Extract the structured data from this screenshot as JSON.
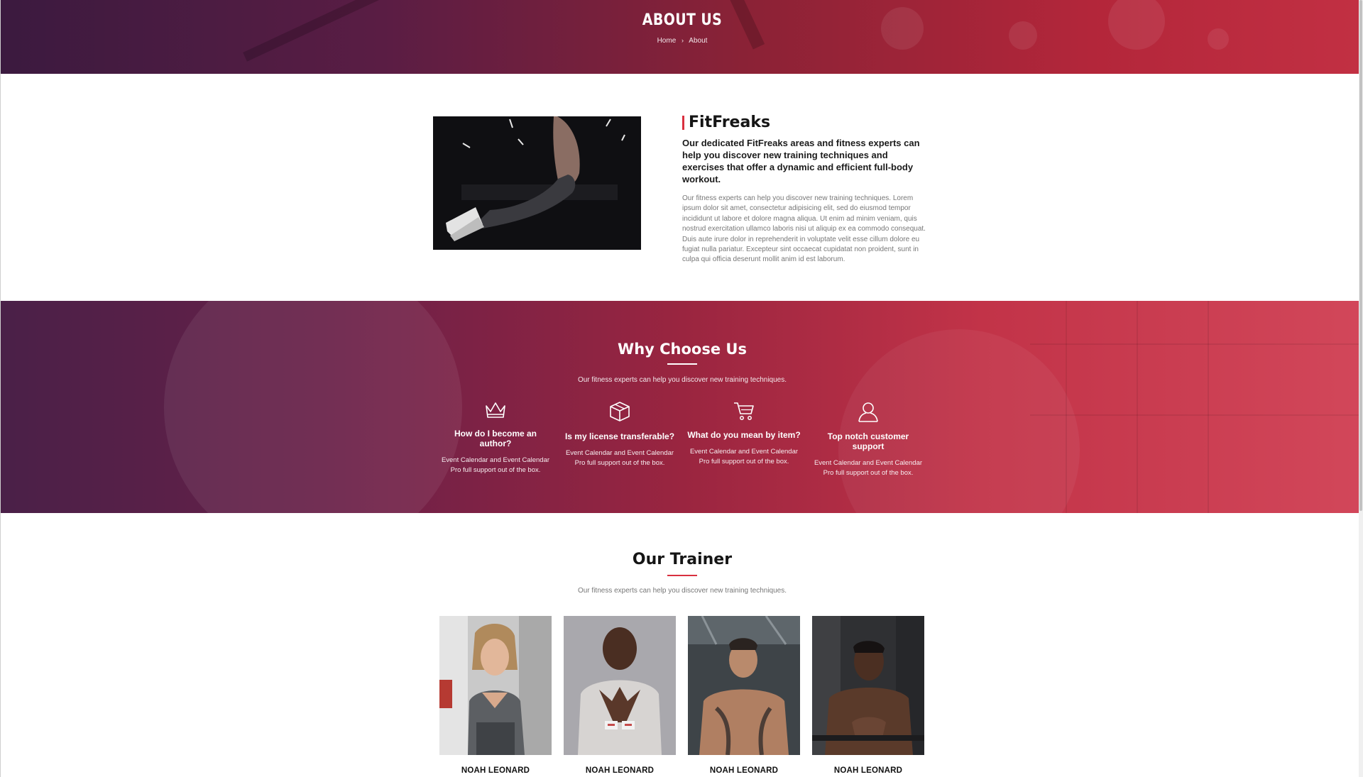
{
  "hero": {
    "title": "ABOUT US",
    "breadcrumb": {
      "home": "Home",
      "separator": "›",
      "current": "About"
    }
  },
  "about": {
    "brand": "FitFreaks",
    "lead": "Our dedicated FitFreaks areas and fitness experts can help you discover new training techniques and exercises that offer a dynamic and efficient full-body workout.",
    "body": "Our fitness experts can help you discover new training techniques. Lorem ipsum dolor sit amet, consectetur adipisicing elit, sed do eiusmod tempor incididunt ut labore et dolore magna aliqua. Ut enim ad minim veniam, quis nostrud exercitation ullamco laboris nisi ut aliquip ex ea commodo consequat. Duis aute irure dolor in reprehenderit in voluptate velit esse cillum dolore eu fugiat nulla pariatur. Excepteur sint occaecat cupidatat non proident, sunt in culpa qui officia deserunt mollit anim id est laborum."
  },
  "why": {
    "title": "Why Choose Us",
    "subtitle": "Our fitness experts can help you discover new training techniques.",
    "features": [
      {
        "icon": "crown-icon",
        "title": "How do I become an author?",
        "desc": "Event Calendar and Event Calendar Pro full support out of the box."
      },
      {
        "icon": "box-icon",
        "title": "Is my license transferable?",
        "desc": "Event Calendar and Event Calendar Pro full support out of the box."
      },
      {
        "icon": "cart-icon",
        "title": "What do you mean by item?",
        "desc": "Event Calendar and Event Calendar Pro full support out of the box."
      },
      {
        "icon": "user-icon",
        "title": "Top notch customer support",
        "desc": "Event Calendar and Event Calendar Pro full support out of the box."
      }
    ]
  },
  "trainers": {
    "title": "Our Trainer",
    "subtitle": "Our fitness experts can help you discover new training techniques.",
    "people": [
      {
        "name": "NOAH LEONARD"
      },
      {
        "name": "NOAH LEONARD"
      },
      {
        "name": "NOAH LEONARD"
      },
      {
        "name": "NOAH LEONARD"
      }
    ]
  },
  "colors": {
    "accent": "#d9303f",
    "hero_start": "#3b1a3f",
    "hero_end": "#c23043"
  }
}
